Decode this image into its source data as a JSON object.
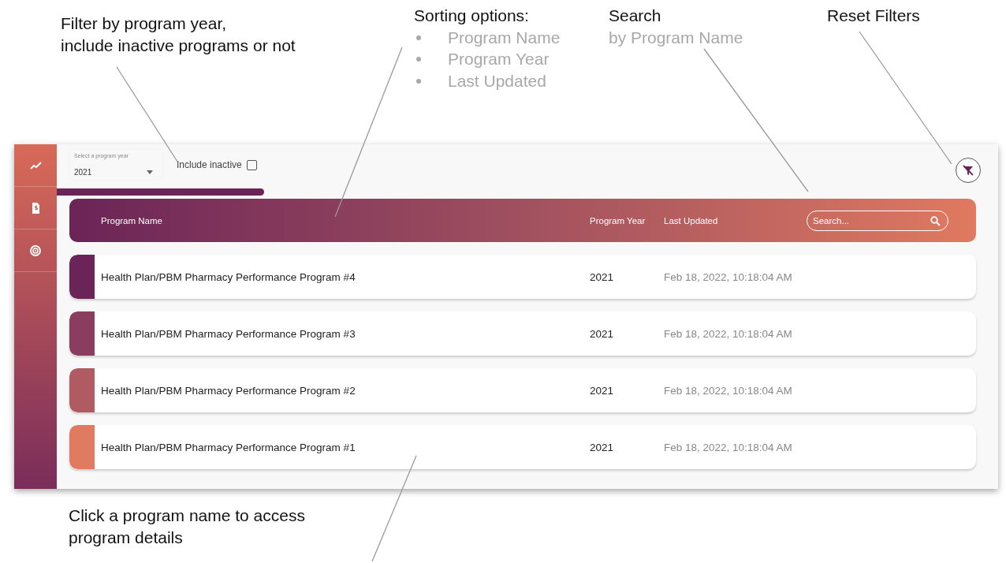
{
  "annotations": [
    {
      "kind": "note",
      "lines": [
        "Filter by program year,",
        "include inactive programs or not"
      ]
    },
    {
      "kind": "list",
      "title": "Sorting options:",
      "bullets": [
        "Program Name",
        "Program Year",
        "Last Updated"
      ]
    },
    {
      "kind": "subtitle",
      "title": "Search",
      "subtitle": "by Program Name"
    },
    {
      "kind": "note",
      "lines": [
        "Reset Filters"
      ]
    }
  ],
  "sidebar": {
    "items": [
      {
        "kind": "chart"
      },
      {
        "kind": "document"
      },
      {
        "kind": "target"
      }
    ]
  },
  "filters": {
    "year_select": {
      "label": "Select a program year",
      "value": "2021"
    },
    "include_inactive": {
      "label": "Include inactive",
      "checked": false
    }
  },
  "table": {
    "columns": [
      "Program Name",
      "Program Year",
      "Last Updated"
    ],
    "search": {
      "placeholder": "Search..."
    },
    "rows": [
      {
        "name": "Health Plan/PBM Pharmacy Performance Program #4",
        "year": "2021",
        "updated": "Feb 18, 2022, 10:18:04 AM",
        "color": "#6b2457"
      },
      {
        "name": "Health Plan/PBM Pharmacy Performance Program #3",
        "year": "2021",
        "updated": "Feb 18, 2022, 10:18:04 AM",
        "color": "#8a3d5e"
      },
      {
        "name": "Health Plan/PBM Pharmacy Performance Program #2",
        "year": "2021",
        "updated": "Feb 18, 2022, 10:18:04 AM",
        "color": "#b05a62"
      },
      {
        "name": "Health Plan/PBM Pharmacy Performance Program #1",
        "year": "2021",
        "updated": "Feb 18, 2022, 10:18:04 AM",
        "color": "#e07a60"
      }
    ]
  },
  "bottom_note": {
    "lines": [
      "Click a program name to access",
      "program details"
    ]
  }
}
